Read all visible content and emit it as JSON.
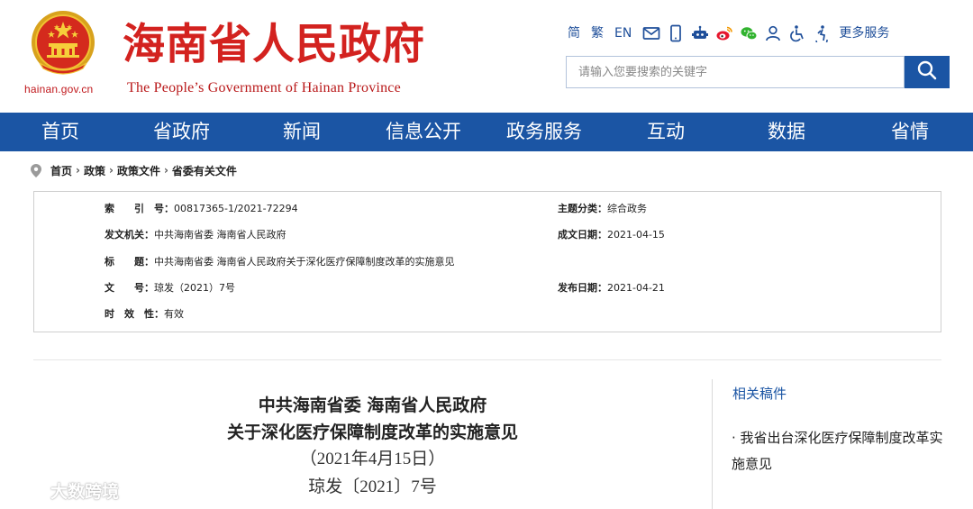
{
  "header": {
    "site_title": "海南省人民政府",
    "site_subtitle": "The People’s Government  of Hainan Province",
    "domain": "hainan.gov.cn",
    "toolbar": {
      "simplified": "简",
      "traditional": "繁",
      "english": "EN",
      "more_services": "更多服务"
    },
    "search": {
      "placeholder": "请输入您要搜索的关键字"
    }
  },
  "nav": {
    "items": [
      "首页",
      "省政府",
      "新闻",
      "信息公开",
      "政务服务",
      "互动",
      "数据",
      "省情"
    ]
  },
  "breadcrumb": [
    "首页",
    "政策",
    "政策文件",
    "省委有关文件"
  ],
  "meta": {
    "index_label": "索　　引　号：",
    "index_value": "00817365-1/2021-72294",
    "topic_label": "主题分类：",
    "topic_value": "综合政务",
    "issuer_label": "发文机关：",
    "issuer_value": "中共海南省委  海南省人民政府",
    "created_label": "成文日期：",
    "created_value": "2021-04-15",
    "title_label": "标　　题：",
    "title_value": "中共海南省委  海南省人民政府关于深化医疗保障制度改革的实施意见",
    "doc_no_label": "文　　号：",
    "doc_no_value": "琼发（2021）7号",
    "published_label": "发布日期：",
    "published_value": "2021-04-21",
    "validity_label": "时　效　性：",
    "validity_value": "有效"
  },
  "article": {
    "title_line1": "中共海南省委  海南省人民政府",
    "title_line2": "关于深化医疗保障制度改革的实施意见",
    "date": "（2021年4月15日）",
    "doc_no": "琼发〔2021〕7号"
  },
  "related": {
    "title": "相关稿件",
    "items": [
      "· 我省出台深化医疗保障制度改革实施意见"
    ]
  },
  "watermark": {
    "text": "大数跨境"
  },
  "colors": {
    "brand_blue": "#1b55a4",
    "title_red": "#d3221f"
  }
}
